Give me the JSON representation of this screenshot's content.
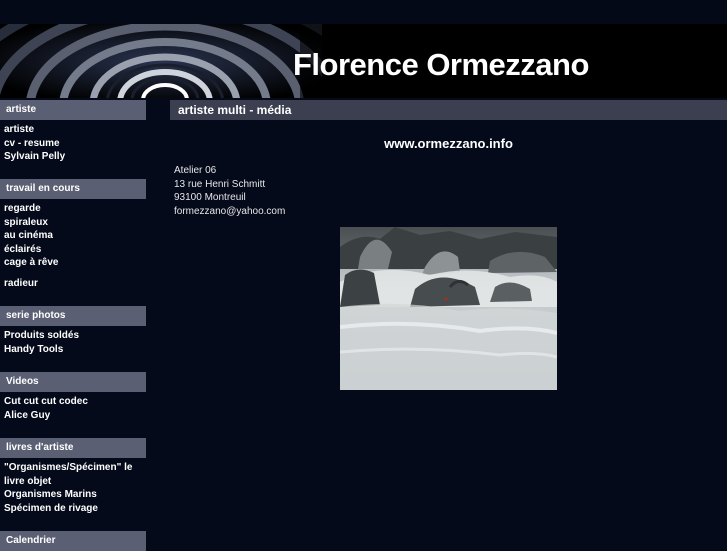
{
  "header": {
    "title": "Florence Ormezzano"
  },
  "sidebar": {
    "sections": [
      {
        "title": "artiste",
        "items": [
          "artiste",
          "cv - resume",
          "Sylvain Pelly"
        ]
      },
      {
        "title": "travail en cours",
        "items": [
          "regarde",
          "spiraleux",
          "au cinéma",
          "éclairés",
          "cage à rêve",
          "radieur"
        ]
      },
      {
        "title": "serie photos",
        "items": [
          "Produits soldés",
          "Handy Tools"
        ]
      },
      {
        "title": "Videos",
        "items": [
          "Cut cut cut codec",
          "Alice Guy"
        ]
      },
      {
        "title": "livres d'artiste",
        "items": [
          "\"Organismes/Spécimen\" le",
          "livre objet",
          "Organismes Marins",
          "Spécimen de rivage"
        ]
      },
      {
        "title": "Calendrier",
        "items": []
      }
    ]
  },
  "main": {
    "header": "artiste multi - média",
    "website": "www.ormezzano.info",
    "address": [
      "Atelier 06",
      "13 rue Henri Schmitt",
      "93100 Montreuil",
      "formezzano@yahoo.com"
    ]
  }
}
